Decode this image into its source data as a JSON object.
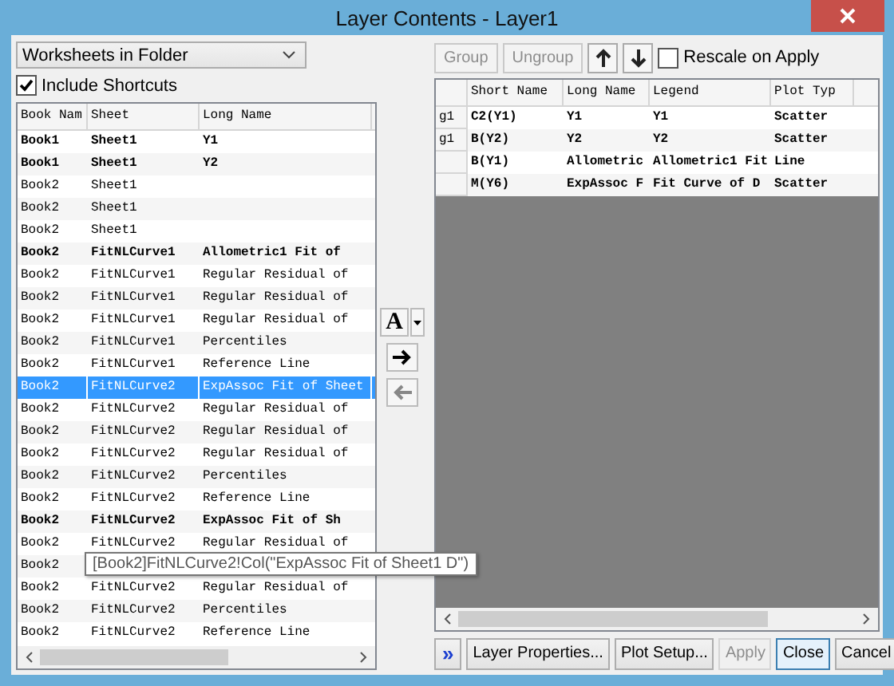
{
  "window": {
    "title": "Layer Contents - Layer1"
  },
  "source_dropdown": {
    "value": "Worksheets in Folder"
  },
  "include_shortcuts": {
    "label": "Include Shortcuts",
    "checked": true
  },
  "left_table": {
    "columns": [
      "Book Nam",
      "Sheet",
      "Long Name"
    ],
    "rows": [
      {
        "cells": [
          "Book1",
          "Sheet1",
          "Y1"
        ],
        "bold": true,
        "selected": false
      },
      {
        "cells": [
          "Book1",
          "Sheet1",
          "Y2"
        ],
        "bold": true,
        "selected": false
      },
      {
        "cells": [
          "Book2",
          "Sheet1"
        ],
        "bold": false,
        "selected": false
      },
      {
        "cells": [
          "Book2",
          "Sheet1"
        ],
        "bold": false,
        "selected": false
      },
      {
        "cells": [
          "Book2",
          "Sheet1"
        ],
        "bold": false,
        "selected": false
      },
      {
        "cells": [
          "Book2",
          "FitNLCurve1",
          "Allometric1 Fit of"
        ],
        "bold": true,
        "selected": false
      },
      {
        "cells": [
          "Book2",
          "FitNLCurve1",
          "Regular Residual of"
        ],
        "bold": false,
        "selected": false
      },
      {
        "cells": [
          "Book2",
          "FitNLCurve1",
          "Regular Residual of"
        ],
        "bold": false,
        "selected": false
      },
      {
        "cells": [
          "Book2",
          "FitNLCurve1",
          "Regular Residual of"
        ],
        "bold": false,
        "selected": false
      },
      {
        "cells": [
          "Book2",
          "FitNLCurve1",
          "Percentiles"
        ],
        "bold": false,
        "selected": false
      },
      {
        "cells": [
          "Book2",
          "FitNLCurve1",
          "Reference Line"
        ],
        "bold": false,
        "selected": false
      },
      {
        "cells": [
          "Book2",
          "FitNLCurve2",
          "ExpAssoc Fit of Sheet"
        ],
        "bold": false,
        "selected": true
      },
      {
        "cells": [
          "Book2",
          "FitNLCurve2",
          "Regular Residual of"
        ],
        "bold": false,
        "selected": false
      },
      {
        "cells": [
          "Book2",
          "FitNLCurve2",
          "Regular Residual of"
        ],
        "bold": false,
        "selected": false
      },
      {
        "cells": [
          "Book2",
          "FitNLCurve2",
          "Regular Residual of"
        ],
        "bold": false,
        "selected": false
      },
      {
        "cells": [
          "Book2",
          "FitNLCurve2",
          "Percentiles"
        ],
        "bold": false,
        "selected": false
      },
      {
        "cells": [
          "Book2",
          "FitNLCurve2",
          "Reference Line"
        ],
        "bold": false,
        "selected": false
      },
      {
        "cells": [
          "Book2",
          "FitNLCurve2",
          "ExpAssoc Fit of Sh"
        ],
        "bold": true,
        "selected": false
      },
      {
        "cells": [
          "Book2",
          "FitNLCurve2",
          "Regular Residual of"
        ],
        "bold": false,
        "selected": false
      },
      {
        "cells": [
          "Book2"
        ],
        "bold": false,
        "selected": false
      },
      {
        "cells": [
          "Book2",
          "FitNLCurve2",
          "Regular Residual of"
        ],
        "bold": false,
        "selected": false
      },
      {
        "cells": [
          "Book2",
          "FitNLCurve2",
          "Percentiles"
        ],
        "bold": false,
        "selected": false
      },
      {
        "cells": [
          "Book2",
          "FitNLCurve2",
          "Reference Line"
        ],
        "bold": false,
        "selected": false
      }
    ]
  },
  "tooltip": "[Book2]FitNLCurve2!Col(\"ExpAssoc Fit of Sheet1 D\")",
  "font_button": {
    "label": "A"
  },
  "side_buttons": [
    {
      "kind": "add",
      "disabled": false
    },
    {
      "kind": "remove",
      "disabled": true
    }
  ],
  "toolbar": [
    {
      "kind": "text",
      "label": "Group",
      "disabled": true
    },
    {
      "kind": "text",
      "label": "Ungroup",
      "disabled": true
    },
    {
      "kind": "up",
      "disabled": false
    },
    {
      "kind": "down",
      "disabled": false
    }
  ],
  "rescale_on_apply": {
    "label": "Rescale on Apply",
    "checked": false
  },
  "right_table": {
    "columns": [
      "Short Name",
      "Long Name",
      "Legend",
      "Plot Typ"
    ],
    "rows": [
      {
        "group": "g1",
        "cells": [
          "C2(Y1)",
          "Y1",
          "Y1",
          "Scatter"
        ]
      },
      {
        "group": "g1",
        "cells": [
          "B(Y2)",
          "Y2",
          "Y2",
          "Scatter"
        ]
      },
      {
        "cells": [
          "B(Y1)",
          "Allometric",
          "Allometric1 Fit",
          "Line"
        ]
      },
      {
        "cells": [
          "M(Y6)",
          "ExpAssoc F",
          "Fit Curve of D",
          "Scatter"
        ]
      }
    ]
  },
  "expand_button": {
    "label": "»"
  },
  "buttons": [
    {
      "label": "Layer Properties...",
      "disabled": false,
      "focused": false
    },
    {
      "label": "Plot Setup...",
      "disabled": false,
      "focused": false
    },
    {
      "label": "Apply",
      "disabled": true,
      "focused": false
    },
    {
      "label": "Close",
      "disabled": false,
      "focused": true
    },
    {
      "label": "Cancel",
      "disabled": false,
      "focused": false
    }
  ]
}
